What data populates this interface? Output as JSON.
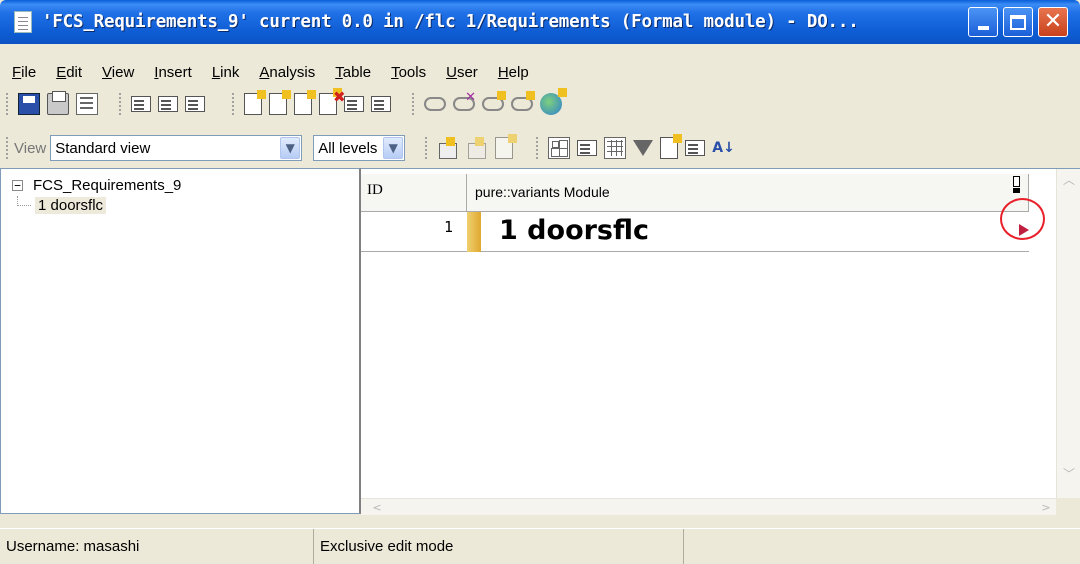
{
  "window": {
    "title": "'FCS_Requirements_9' current 0.0 in /flc 1/Requirements (Formal module) - DO..."
  },
  "menu": [
    "File",
    "Edit",
    "View",
    "Insert",
    "Link",
    "Analysis",
    "Table",
    "Tools",
    "User",
    "Help"
  ],
  "toolbar2": {
    "view_label": "View",
    "view_select": "Standard view",
    "levels_select": "All levels"
  },
  "tree": {
    "root": "FCS_Requirements_9",
    "child": "1 doorsflc"
  },
  "grid": {
    "columns": [
      "ID",
      "pure::variants Module"
    ],
    "rows": [
      {
        "id": "1",
        "text": "1 doorsflc"
      }
    ]
  },
  "status": {
    "username": "Username: masashi",
    "mode": "Exclusive edit mode"
  },
  "colors": {
    "titlebar": "#0f5ed6",
    "highlight_circle": "#e8202a",
    "heading_bar": "#e0a830"
  }
}
